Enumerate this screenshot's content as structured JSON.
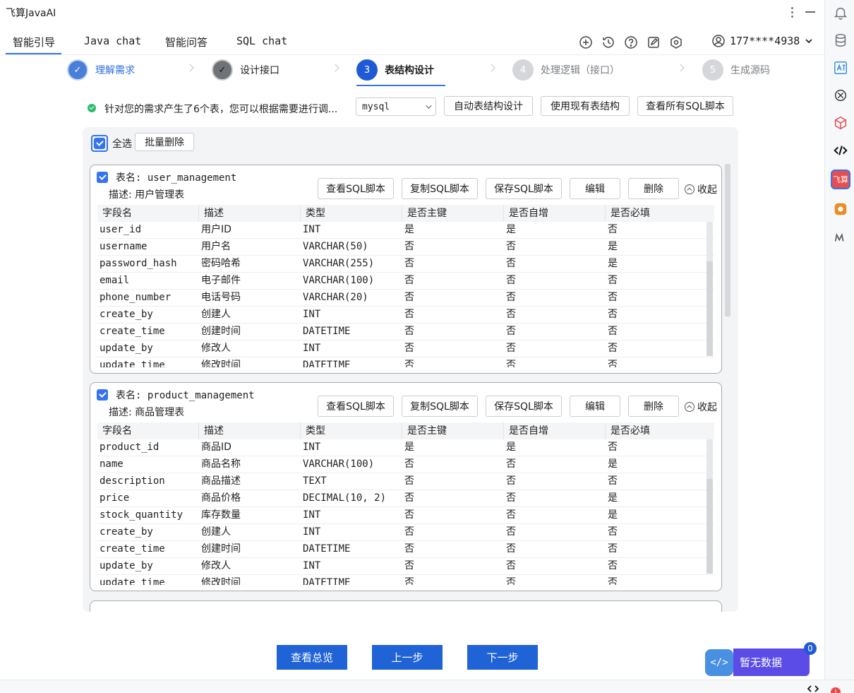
{
  "app": {
    "title": "飞算JavaAI"
  },
  "tabs": [
    {
      "label": "智能引导",
      "active": true
    },
    {
      "label": "Java chat",
      "active": false
    },
    {
      "label": "智能问答",
      "active": false
    },
    {
      "label": "SQL chat",
      "active": false
    }
  ],
  "header_icons": [
    "plus-circle-icon",
    "history-icon",
    "help-icon",
    "edit-icon",
    "settings-icon"
  ],
  "account": {
    "label": "177****4938"
  },
  "steps": [
    {
      "number": "✓",
      "label": "理解需求",
      "state": "done"
    },
    {
      "number": "✓",
      "label": "设计接口",
      "state": "done-gray"
    },
    {
      "number": "3",
      "label": "表结构设计",
      "state": "current"
    },
    {
      "number": "4",
      "label": "处理逻辑（接口）",
      "state": "pending"
    },
    {
      "number": "5",
      "label": "生成源码",
      "state": "pending"
    }
  ],
  "action_row": {
    "status_text": "针对您的需求产生了6个表，您可以根据需要进行调...",
    "db_select": "mysql",
    "buttons": [
      "自动表结构设计",
      "使用现有表结构",
      "查看所有SQL脚本"
    ]
  },
  "panel": {
    "select_all_label": "全选",
    "bulk_delete_label": "批量删除"
  },
  "card_actions": {
    "view_sql": "查看SQL脚本",
    "copy_sql": "复制SQL脚本",
    "save_sql": "保存SQL脚本",
    "edit": "编辑",
    "delete": "删除",
    "collapse": "收起"
  },
  "columns": [
    "字段名",
    "描述",
    "类型",
    "是否主键",
    "是否自增",
    "是否必填"
  ],
  "tables": [
    {
      "name": "表名: user_management",
      "desc": "描述: 用户管理表",
      "rows": [
        [
          "user_id",
          "用户ID",
          "INT",
          "是",
          "是",
          "否"
        ],
        [
          "username",
          "用户名",
          "VARCHAR(50)",
          "否",
          "否",
          "是"
        ],
        [
          "password_hash",
          "密码哈希",
          "VARCHAR(255)",
          "否",
          "否",
          "是"
        ],
        [
          "email",
          "电子邮件",
          "VARCHAR(100)",
          "否",
          "否",
          "否"
        ],
        [
          "phone_number",
          "电话号码",
          "VARCHAR(20)",
          "否",
          "否",
          "否"
        ],
        [
          "create_by",
          "创建人",
          "INT",
          "否",
          "否",
          "否"
        ],
        [
          "create_time",
          "创建时间",
          "DATETIME",
          "否",
          "否",
          "否"
        ],
        [
          "update_by",
          "修改人",
          "INT",
          "否",
          "否",
          "否"
        ],
        [
          "update_time",
          "修改时间",
          "DATETIME",
          "否",
          "否",
          "否"
        ]
      ]
    },
    {
      "name": "表名: product_management",
      "desc": "描述: 商品管理表",
      "rows": [
        [
          "product_id",
          "商品ID",
          "INT",
          "是",
          "是",
          "否"
        ],
        [
          "name",
          "商品名称",
          "VARCHAR(100)",
          "否",
          "否",
          "是"
        ],
        [
          "description",
          "商品描述",
          "TEXT",
          "否",
          "否",
          "否"
        ],
        [
          "price",
          "商品价格",
          "DECIMAL(10, 2)",
          "否",
          "否",
          "是"
        ],
        [
          "stock_quantity",
          "库存数量",
          "INT",
          "否",
          "否",
          "是"
        ],
        [
          "create_by",
          "创建人",
          "INT",
          "否",
          "否",
          "否"
        ],
        [
          "create_time",
          "创建时间",
          "DATETIME",
          "否",
          "否",
          "否"
        ],
        [
          "update_by",
          "修改人",
          "INT",
          "否",
          "否",
          "否"
        ],
        [
          "update_time",
          "修改时间",
          "DATETIME",
          "否",
          "否",
          "否"
        ]
      ]
    }
  ],
  "bottom_nav": {
    "overview": "查看总览",
    "prev": "上一步",
    "next": "下一步"
  },
  "float_chat": {
    "label": "暂无数据",
    "badge": "0",
    "icon": "</>"
  },
  "toolstrip": {
    "brand_label": "飞算"
  },
  "statusbar": {
    "error_count": "!"
  },
  "colors": {
    "accent": "#3574f0",
    "primary_button": "#1f63d6",
    "success": "#2ebd6b"
  }
}
